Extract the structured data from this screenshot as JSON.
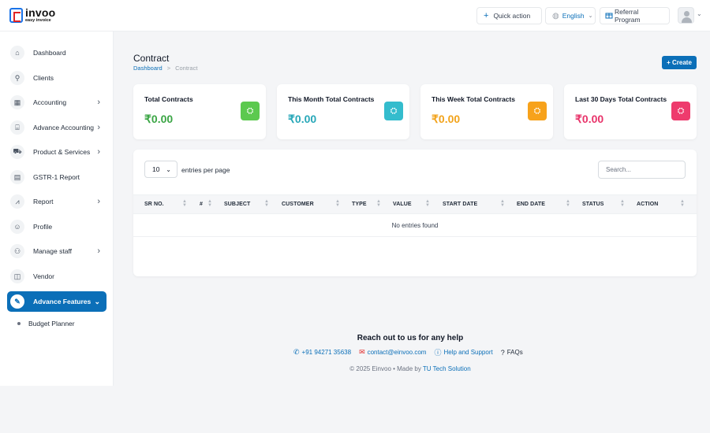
{
  "brand": {
    "name": "invoo",
    "tagline": "easy invoice"
  },
  "header": {
    "quick_action": "Quick action",
    "language": "English",
    "referral": "Referral Program"
  },
  "sidebar": {
    "items": [
      {
        "label": "Dashboard",
        "icon": "home-icon"
      },
      {
        "label": "Clients",
        "icon": "user-plus-icon"
      },
      {
        "label": "Accounting",
        "icon": "calculator-icon"
      },
      {
        "label": "Advance Accounting",
        "icon": "bank-icon"
      },
      {
        "label": "Product & Services",
        "icon": "cart-icon"
      },
      {
        "label": "GSTR-1 Report",
        "icon": "file-icon"
      },
      {
        "label": "Report",
        "icon": "chart-line-icon"
      },
      {
        "label": "Profile",
        "icon": "user-icon"
      },
      {
        "label": "Manage staff",
        "icon": "users-icon"
      },
      {
        "label": "Vendor",
        "icon": "note-icon"
      },
      {
        "label": "Advance Features",
        "icon": "rocket-icon"
      }
    ],
    "sub_items": [
      {
        "label": "Budget Planner"
      }
    ]
  },
  "page": {
    "title": "Contract",
    "breadcrumb": {
      "home": "Dashboard",
      "separator": ">",
      "current": "Contract"
    },
    "create_label": "+ Create"
  },
  "cards": [
    {
      "label": "Total Contracts",
      "value": "₹0.00",
      "color": "#3aa544",
      "icon_bg": "#5cc94f"
    },
    {
      "label": "This Month Total Contracts",
      "value": "₹0.00",
      "color": "#27a7b8",
      "icon_bg": "#34bccd"
    },
    {
      "label": "This Week Total Contracts",
      "value": "₹0.00",
      "color": "#f2a31b",
      "icon_bg": "#f7a21b"
    },
    {
      "label": "Last 30 Days Total Contracts",
      "value": "₹0.00",
      "color": "#e8336a",
      "icon_bg": "#ee3b6d"
    }
  ],
  "table": {
    "page_size": "10",
    "entries_label": "entries per page",
    "search_placeholder": "Search...",
    "columns": [
      "SR NO.",
      "#",
      "SUBJECT",
      "CUSTOMER",
      "TYPE",
      "VALUE",
      "START DATE",
      "END DATE",
      "STATUS",
      "ACTION"
    ],
    "empty_message": "No entries found"
  },
  "footer": {
    "title": "Reach out to us for any help",
    "phone": "+91 94271 35638",
    "email": "contact@einvoo.com",
    "help": "Help and Support",
    "faqs": "FAQs",
    "copyright_prefix": "© 2025 Einvoo  •  Made by ",
    "company": "TU Tech Solution"
  },
  "colors": {
    "primary": "#0b6fb8",
    "danger": "#e02424"
  }
}
